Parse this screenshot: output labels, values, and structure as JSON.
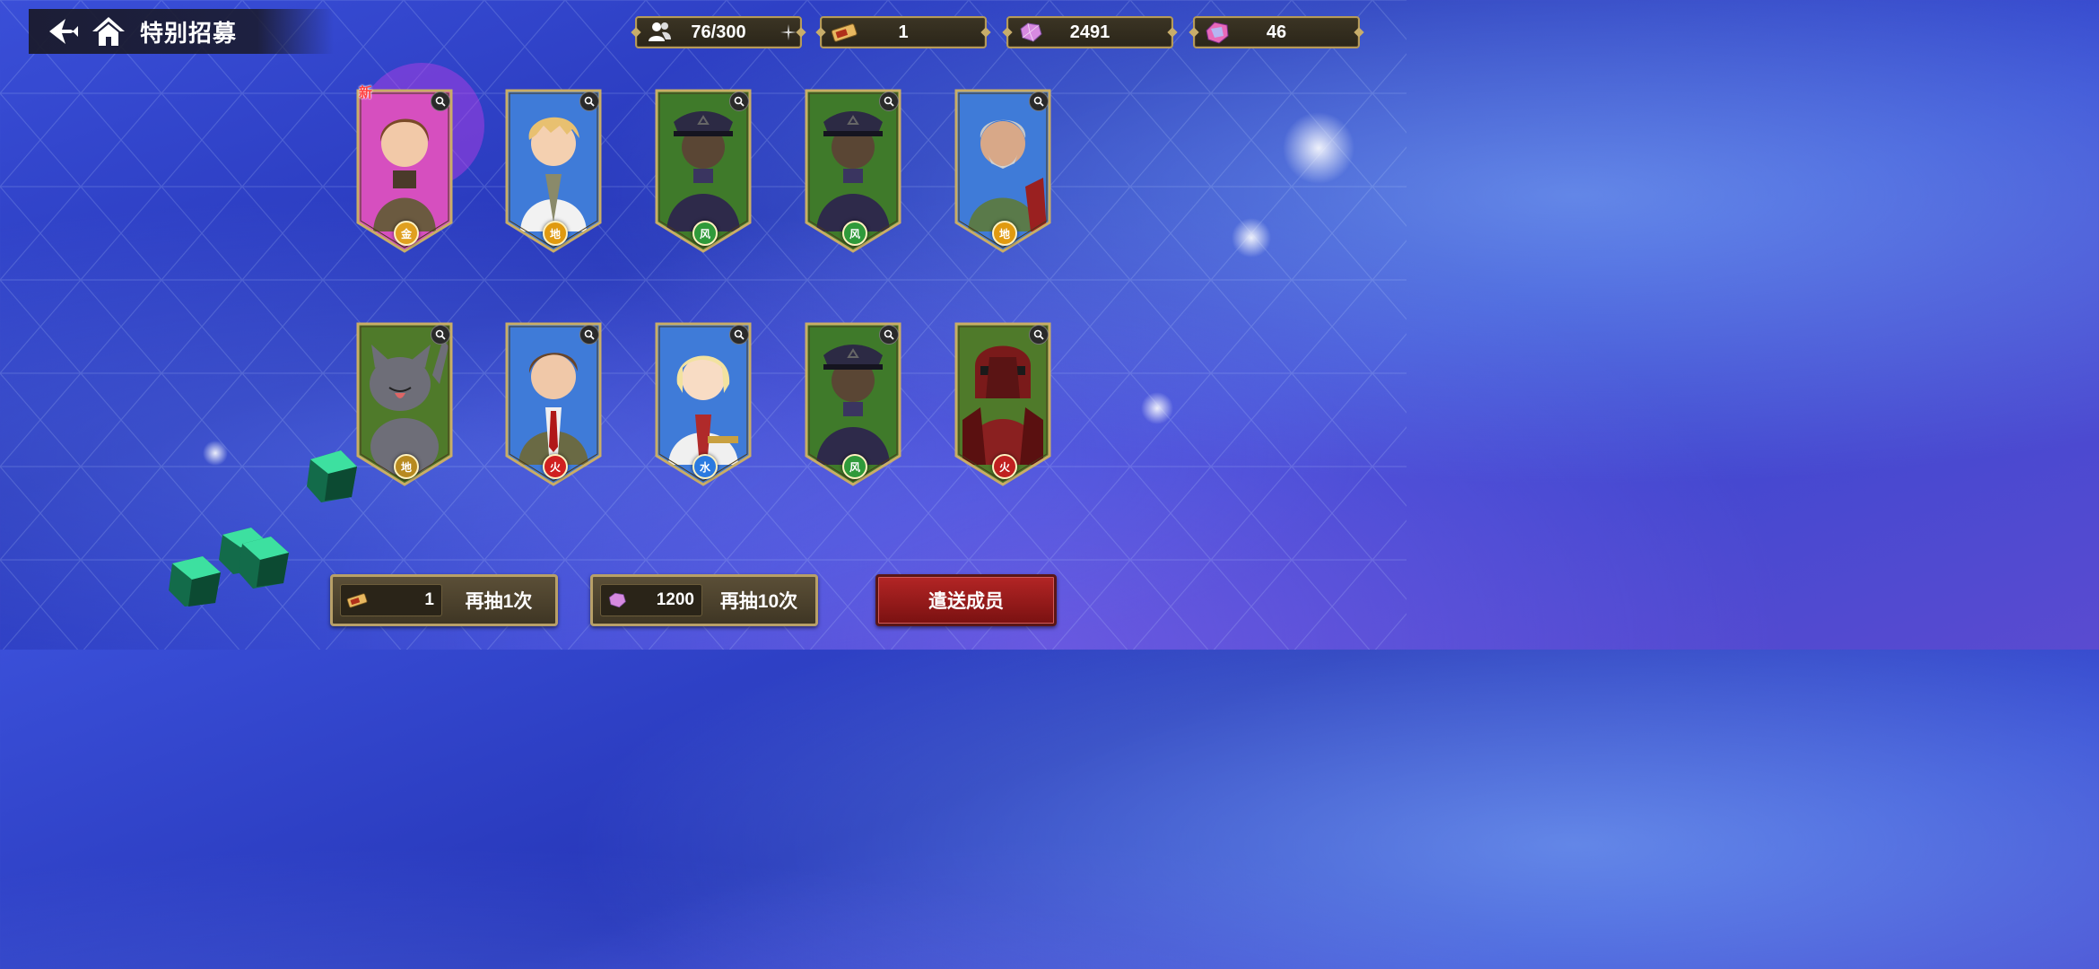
{
  "header": {
    "title": "特别招募",
    "back_icon": "back-arrow-icon",
    "home_icon": "home-icon"
  },
  "resources": {
    "members": {
      "value": "76/300",
      "icon": "members-icon"
    },
    "tickets": {
      "value": "1",
      "icon": "ticket-icon"
    },
    "crystals_a": {
      "value": "2491",
      "icon": "crystal-icon"
    },
    "crystals_b": {
      "value": "46",
      "icon": "premium-crystal-icon"
    }
  },
  "cards": [
    {
      "id": "c1",
      "new_label": "新",
      "element": "金",
      "element_color": "#e0a020",
      "bg": "#d64fbf",
      "portrait": "brown-hair-youth"
    },
    {
      "id": "c2",
      "element": "地",
      "element_color": "#e09a10",
      "bg": "#3f7bd8",
      "portrait": "blonde-youth"
    },
    {
      "id": "c3",
      "element": "风",
      "element_color": "#2f9a3a",
      "bg": "#3f7a2a",
      "portrait": "capped-soldier"
    },
    {
      "id": "c4",
      "element": "风",
      "element_color": "#2f9a3a",
      "bg": "#3f7a2a",
      "portrait": "capped-soldier"
    },
    {
      "id": "c5",
      "element": "地",
      "element_color": "#e09a10",
      "bg": "#3f7bd8",
      "portrait": "grey-bearded-officer"
    },
    {
      "id": "c6",
      "element": "地",
      "element_color": "#b88a20",
      "bg": "#4f7a2a",
      "portrait": "grey-cat"
    },
    {
      "id": "c7",
      "element": "火",
      "element_color": "#d02020",
      "bg": "#3f7bd8",
      "portrait": "brown-hair-man-tie"
    },
    {
      "id": "c8",
      "element": "水",
      "element_color": "#2a7ae0",
      "bg": "#3f7bd8",
      "portrait": "blonde-woman"
    },
    {
      "id": "c9",
      "element": "风",
      "element_color": "#2f9a3a",
      "bg": "#3f7a2a",
      "portrait": "capped-soldier"
    },
    {
      "id": "c10",
      "element": "火",
      "element_color": "#c02020",
      "bg": "#4f7a2a",
      "portrait": "red-armored-knight"
    }
  ],
  "actions": {
    "redraw_one": {
      "cost": "1",
      "label": "再抽1次",
      "cost_icon": "ticket-icon"
    },
    "redraw_ten": {
      "cost": "1200",
      "label": "再抽10次",
      "cost_icon": "crystal-icon"
    },
    "dispatch": {
      "label": "遣送成员"
    }
  },
  "colors": {
    "gold_border": "#b59a5a",
    "dispatch_red": "#a51f1f",
    "background_blue": "#2f40c8"
  }
}
